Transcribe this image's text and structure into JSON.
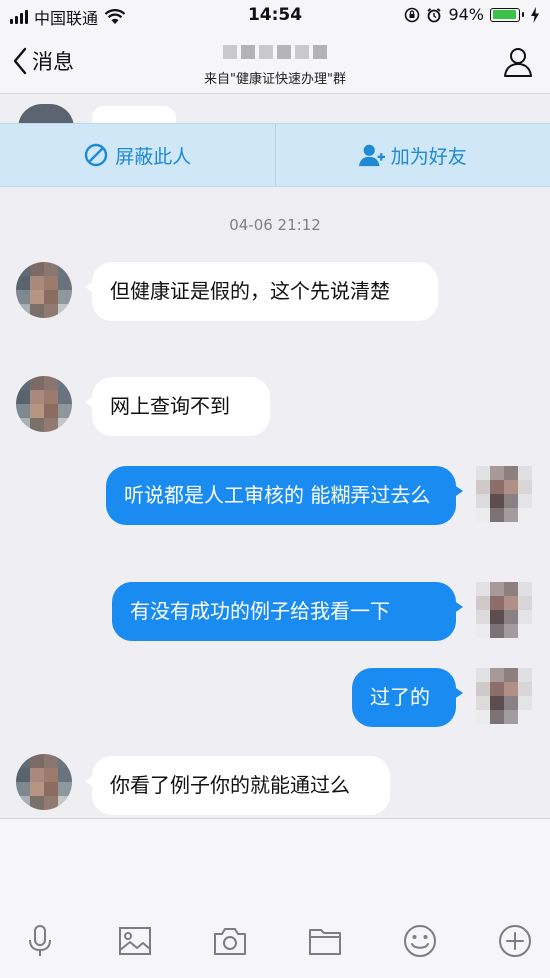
{
  "status_bar": {
    "carrier": "中国联通",
    "time": "14:54",
    "battery_percent": "94%",
    "battery_level": 0.94
  },
  "nav": {
    "back_label": "消息",
    "subtitle": "来自\"健康证快速办理\"群"
  },
  "actions": {
    "block_label": "屏蔽此人",
    "add_friend_label": "加为好友"
  },
  "chat": {
    "timestamp": "04-06 21:12",
    "messages": [
      {
        "from": "them",
        "text": "但健康证是假的，这个先说清楚"
      },
      {
        "from": "them",
        "text": "网上查询不到"
      },
      {
        "from": "me",
        "text": "听说都是人工审核的 能糊弄过去么"
      },
      {
        "from": "me",
        "text": "有没有成功的例子给我看一下"
      },
      {
        "from": "me",
        "text": "过了的"
      },
      {
        "from": "them",
        "text": "你看了例子你的就能通过么"
      }
    ]
  },
  "toolbar": {
    "icons": [
      "microphone-icon",
      "image-icon",
      "camera-icon",
      "folder-icon",
      "emoji-icon",
      "plus-icon"
    ]
  },
  "colors": {
    "accent_blue": "#1a8bf0",
    "action_strip": "#cfe7f6",
    "action_text": "#1e8ad6",
    "battery_green": "#3bc24d"
  }
}
